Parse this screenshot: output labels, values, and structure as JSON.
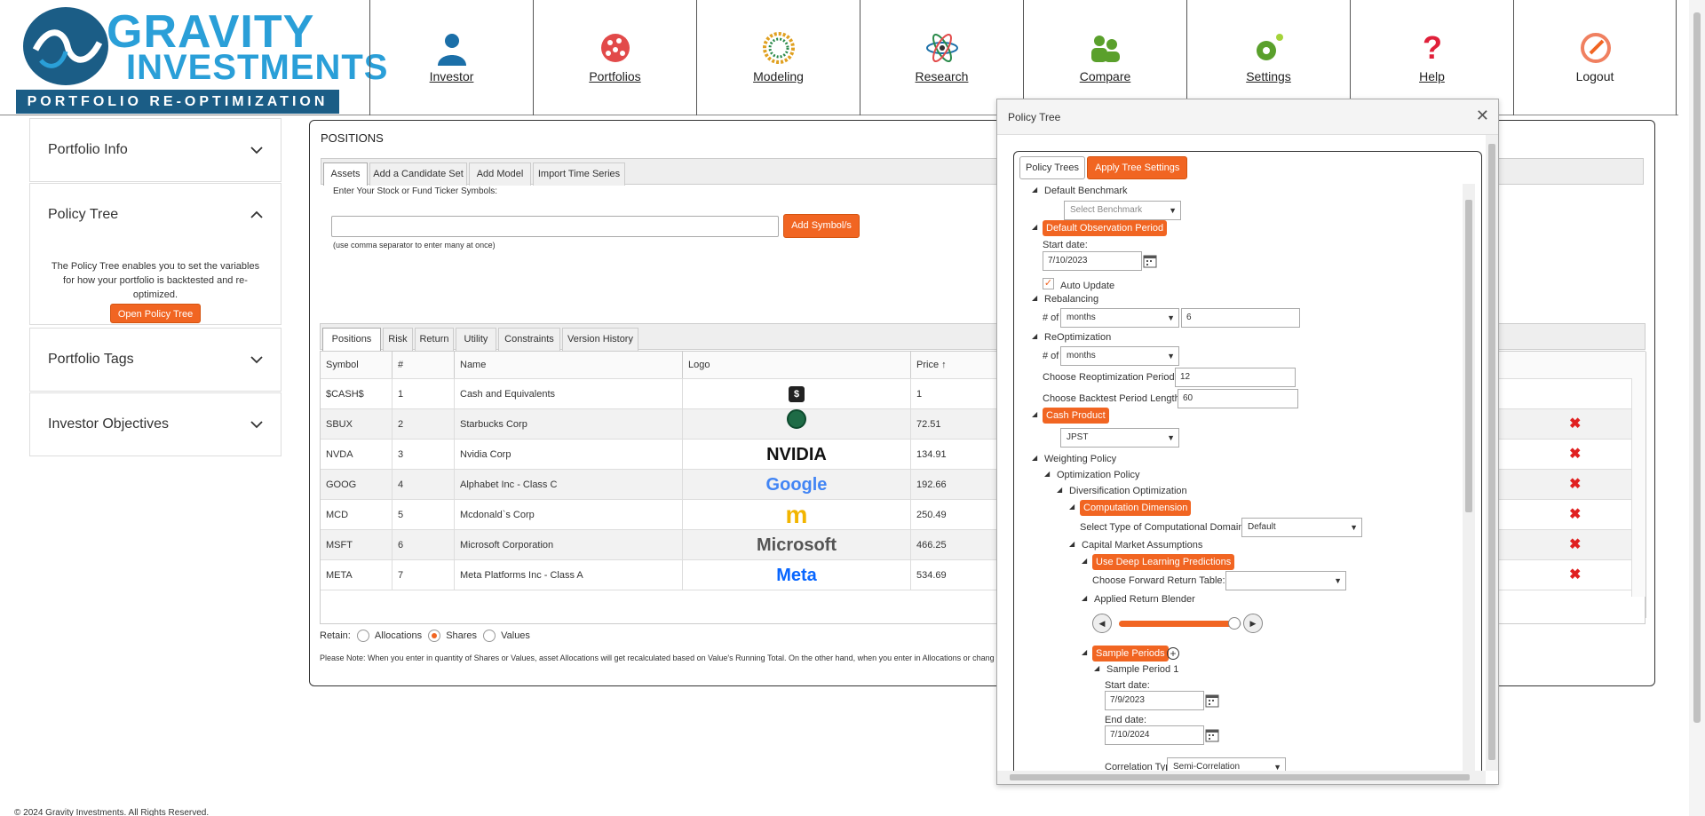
{
  "brand": {
    "name_line1": "GRAVITY",
    "name_line2": "INVESTMENTS",
    "tagline": "PORTFOLIO RE-OPTIMIZATION"
  },
  "nav": [
    {
      "label": "Investor",
      "icon": "investor-icon"
    },
    {
      "label": "Portfolios",
      "icon": "portfolios-icon"
    },
    {
      "label": "Modeling",
      "icon": "modeling-icon"
    },
    {
      "label": "Research",
      "icon": "research-icon"
    },
    {
      "label": "Compare",
      "icon": "compare-icon"
    },
    {
      "label": "Settings",
      "icon": "settings-icon"
    },
    {
      "label": "Help",
      "icon": "help-icon"
    },
    {
      "label": "Logout",
      "icon": "logout-icon"
    }
  ],
  "sidebar": {
    "portfolio_info": "Portfolio Info",
    "policy_tree": "Policy Tree",
    "policy_tree_desc": "The Policy Tree enables you to set the variables for how your portfolio is backtested and re-optimized.",
    "open_policy_tree": "Open Policy Tree",
    "portfolio_tags": "Portfolio Tags",
    "investor_objectives": "Investor Objectives"
  },
  "positions": {
    "title": "POSITIONS",
    "top_tabs": [
      "Assets",
      "Add a Candidate Set",
      "Add Model",
      "Import Time Series"
    ],
    "symbol_label": "Enter Your Stock or Fund Ticker Symbols:",
    "symbol_placeholder": "",
    "add_symbol": "Add Symbol/s",
    "symbol_hint": "(use comma separator to enter many at once)",
    "bottom_tabs": [
      "Positions",
      "Risk",
      "Return",
      "Utility",
      "Constraints",
      "Version History"
    ],
    "columns": {
      "symbol": "Symbol",
      "num": "#",
      "name": "Name",
      "logo": "Logo",
      "price": "Price"
    },
    "rows": [
      {
        "symbol": "$CASH$",
        "num": "1",
        "name": "Cash and Equivalents",
        "logo": "cash-logo",
        "price": "1",
        "deletable": false
      },
      {
        "symbol": "SBUX",
        "num": "2",
        "name": "Starbucks Corp",
        "logo": "starbucks-logo",
        "price": "72.51",
        "deletable": true
      },
      {
        "symbol": "NVDA",
        "num": "3",
        "name": "Nvidia Corp",
        "logo": "NVIDIA",
        "price": "134.91",
        "deletable": true
      },
      {
        "symbol": "GOOG",
        "num": "4",
        "name": "Alphabet Inc - Class C",
        "logo": "Google",
        "price": "192.66",
        "deletable": true
      },
      {
        "symbol": "MCD",
        "num": "5",
        "name": "Mcdonald`s Corp",
        "logo": "mcdonalds-logo",
        "price": "250.49",
        "deletable": true
      },
      {
        "symbol": "MSFT",
        "num": "6",
        "name": "Microsoft Corporation",
        "logo": "Microsoft",
        "price": "466.25",
        "deletable": true
      },
      {
        "symbol": "META",
        "num": "7",
        "name": "Meta Platforms Inc - Class A",
        "logo": "Meta",
        "price": "534.69",
        "deletable": true
      }
    ],
    "retain_label": "Retain:",
    "retain_options": [
      "Allocations",
      "Shares",
      "Values"
    ],
    "retain_selected": "Shares",
    "note": "Please Note: When you enter in quantity of Shares or Values, asset Allocations will get recalculated based on Value's Running Total. On the other hand, when you enter in Allocations or change t"
  },
  "modal": {
    "title": "Policy Tree",
    "tabs": [
      "Policy Trees",
      "Apply Tree Settings"
    ],
    "tree": {
      "default_benchmark": "Default Benchmark",
      "benchmark_placeholder": "Select Benchmark",
      "default_observation_period": "Default Observation Period",
      "start_date_label": "Start date:",
      "start_date": "7/10/2023",
      "auto_update": "Auto Update",
      "rebalancing": "Rebalancing",
      "of_label": "# of",
      "rebalancing_unit": "months",
      "rebalancing_value": "6",
      "reoptimization": "ReOptimization",
      "reoptimization_unit": "months",
      "reopt_period_label": "Choose Reoptimization Period:",
      "reopt_period": "12",
      "backtest_label": "Choose Backtest Period Length:",
      "backtest_value": "60",
      "cash_product": "Cash Product",
      "cash_product_value": "JPST",
      "weighting_policy": "Weighting Policy",
      "optimization_policy": "Optimization Policy",
      "diversification_optimization": "Diversification Optimization",
      "computation_dimension": "Computation Dimension",
      "computational_domain_label": "Select Type of Computational Domain:",
      "computational_domain": "Default",
      "capital_market_assumptions": "Capital Market Assumptions",
      "deep_learning": "Use Deep Learning Predictions",
      "forward_return_label": "Choose Forward Return Table:",
      "forward_return": "",
      "applied_return_blender": "Applied Return Blender",
      "blender_level": 0.94,
      "sample_periods": "Sample Periods",
      "sample_period_1": "Sample Period 1",
      "sp_start_label": "Start date:",
      "sp_start": "7/9/2023",
      "sp_end_label": "End date:",
      "sp_end": "7/10/2024",
      "correlation_label": "Correlation Type:",
      "correlation": "Semi-Correlation"
    }
  },
  "footer": {
    "copyright": "© 2024 Gravity Investments. All Rights Reserved."
  },
  "colors": {
    "accent": "#f16522",
    "brand_dark": "#1b5d86",
    "brand_light": "#2a9fd8",
    "delete": "#e02020"
  }
}
